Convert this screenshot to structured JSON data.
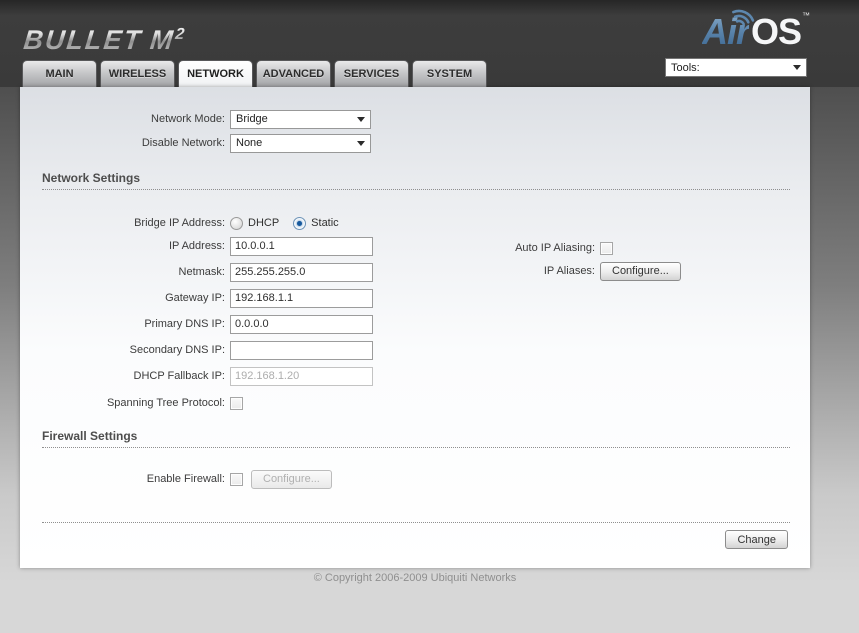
{
  "header": {
    "brand": "BULLET",
    "brand_model": "M",
    "brand_model_sup": "2",
    "logo_air": "Air",
    "logo_os": "OS",
    "logo_tm": "™",
    "tools_label": "Tools:"
  },
  "tabs": [
    {
      "label": "MAIN"
    },
    {
      "label": "WIRELESS"
    },
    {
      "label": "NETWORK"
    },
    {
      "label": "ADVANCED"
    },
    {
      "label": "SERVICES"
    },
    {
      "label": "SYSTEM"
    }
  ],
  "active_tab": "NETWORK",
  "top_form": {
    "network_mode_label": "Network Mode:",
    "network_mode_value": "Bridge",
    "disable_network_label": "Disable Network:",
    "disable_network_value": "None"
  },
  "network_settings": {
    "title": "Network Settings",
    "bridge_ip_label": "Bridge IP Address:",
    "dhcp_option": "DHCP",
    "static_option": "Static",
    "selected_option": "Static",
    "fields": [
      {
        "label": "IP Address:",
        "value": "10.0.0.1",
        "disabled": false
      },
      {
        "label": "Netmask:",
        "value": "255.255.255.0",
        "disabled": false
      },
      {
        "label": "Gateway IP:",
        "value": "192.168.1.1",
        "disabled": false
      },
      {
        "label": "Primary DNS IP:",
        "value": "0.0.0.0",
        "disabled": false
      },
      {
        "label": "Secondary DNS IP:",
        "value": "",
        "disabled": false
      },
      {
        "label": "DHCP Fallback IP:",
        "value": "192.168.1.20",
        "disabled": true
      }
    ],
    "stp_label": "Spanning Tree Protocol:",
    "stp_checked": false,
    "auto_ip_label": "Auto IP Aliasing:",
    "auto_ip_checked": false,
    "ip_aliases_label": "IP Aliases:",
    "ip_aliases_button": "Configure..."
  },
  "firewall_settings": {
    "title": "Firewall Settings",
    "enable_label": "Enable Firewall:",
    "enable_checked": false,
    "configure_button": "Configure...",
    "configure_disabled": true
  },
  "actions": {
    "change_button": "Change"
  },
  "footer": {
    "copyright": "© Copyright 2006-2009 Ubiquiti Networks"
  },
  "colors": {
    "accent_blue": "#5d87ae",
    "header_bg": "#3a3a3a",
    "selected_radio": "#16599d"
  }
}
